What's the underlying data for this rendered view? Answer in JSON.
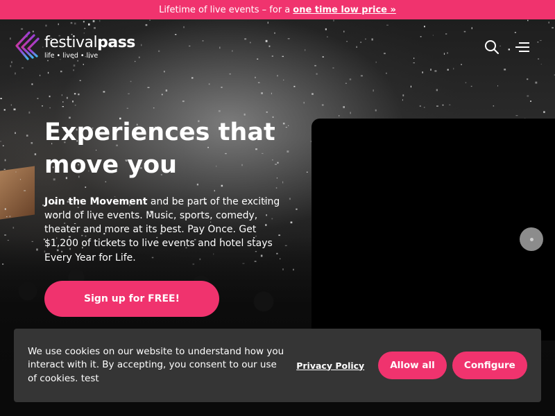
{
  "promo": {
    "text": "Lifetime of live events – for a",
    "link": "one time low price »"
  },
  "header": {
    "logo_name_light": "festival",
    "logo_name_bold": "pass",
    "logo_tagline": "life • lived • live",
    "icons": [
      "search-icon",
      "menu-icon"
    ]
  },
  "hero": {
    "title": "Experiences that move you",
    "lead_bold": "Join the Movement",
    "lead_rest": " and be part of the exciting world of live events. Music, sports, comedy, theater and more at its best. Pay Once. Get $1,200 of tickets to live events and hotel stays Every Year for Life.",
    "cta_label": "Sign up for FREE!"
  },
  "cookie": {
    "text": "We use cookies on our website to understand how you interact with it. By accepting, you consent to our use of cookies. test",
    "privacy_label": "Privacy Policy",
    "allow_label": "Allow all",
    "configure_label": "Configure"
  },
  "colors": {
    "accent": "#f0336e",
    "cookie_bg": "#353535",
    "video_bg": "#000000"
  }
}
